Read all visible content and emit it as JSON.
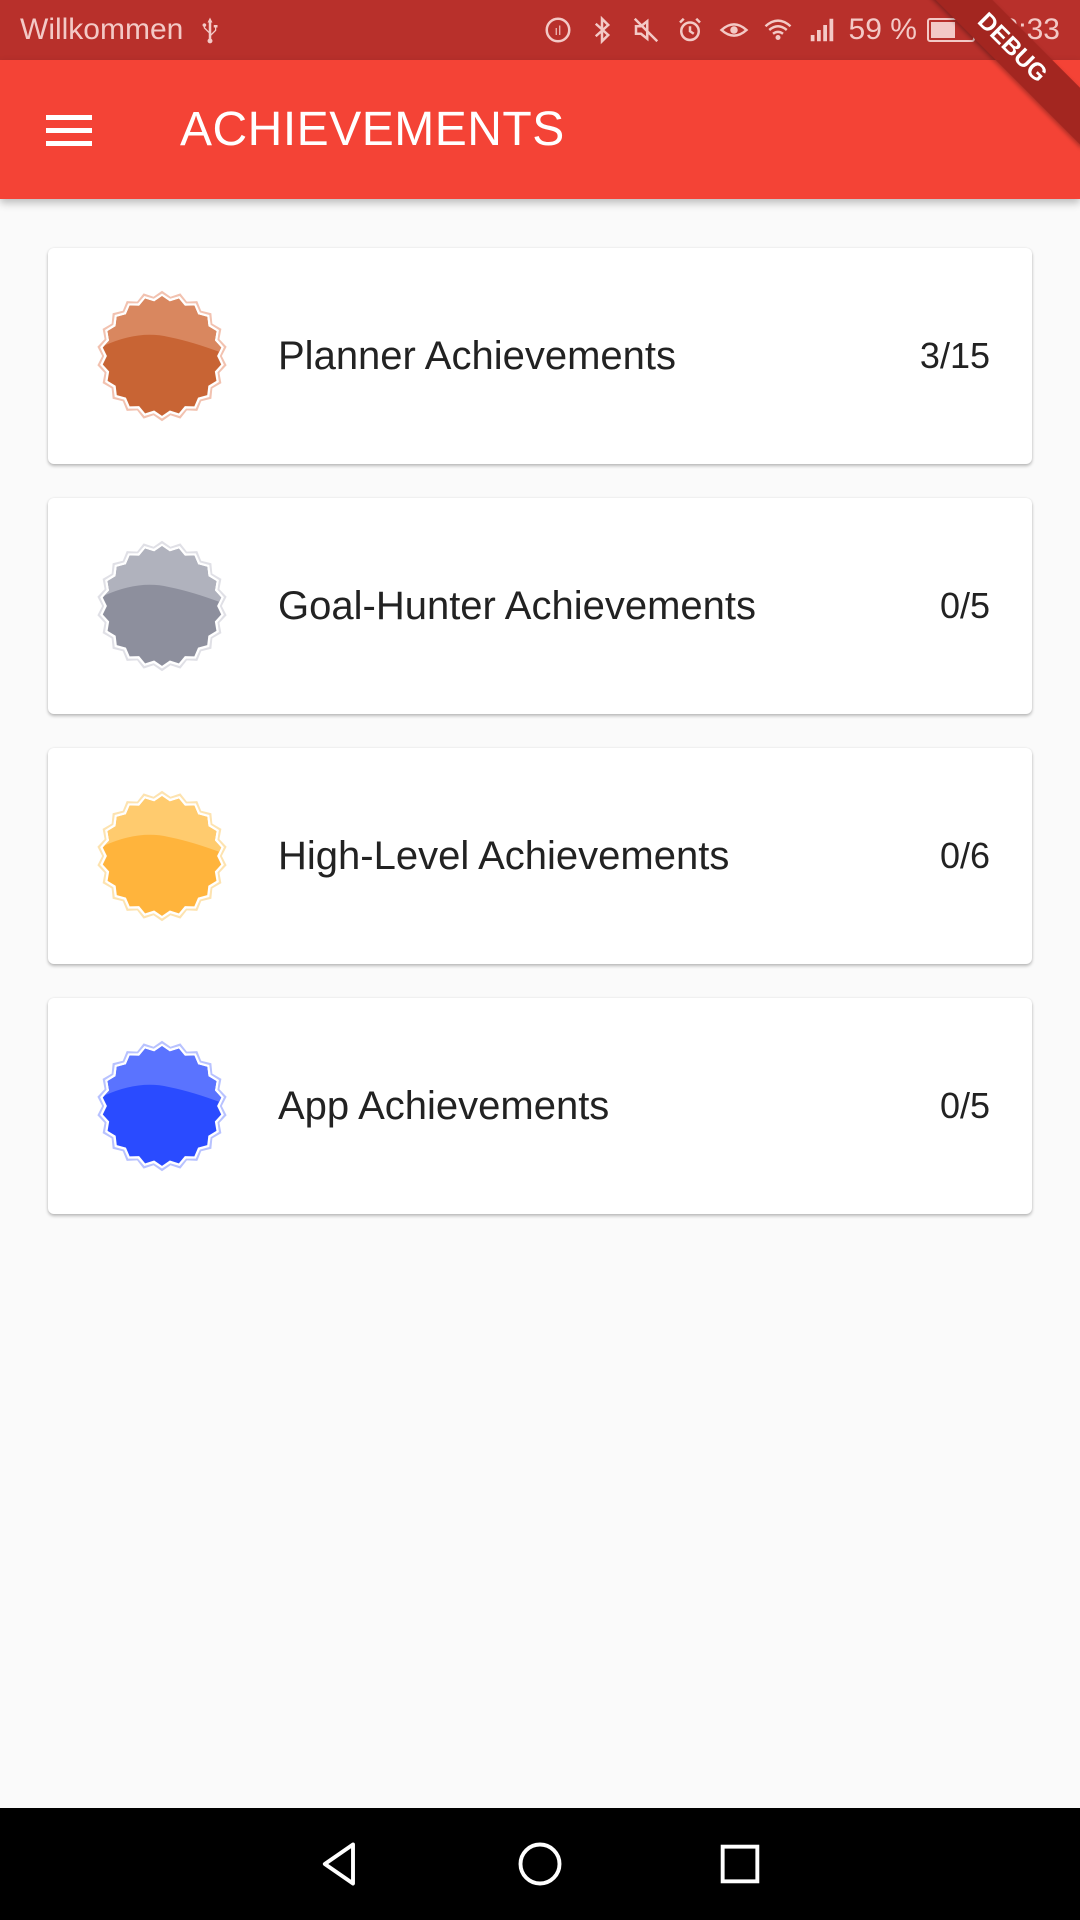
{
  "status_bar": {
    "carrier": "Willkommen",
    "battery_percent": "59 %",
    "battery_level": 0.59,
    "time": "12:33",
    "icons": [
      "usb-icon",
      "data-saver-icon",
      "bluetooth-icon",
      "mute-icon",
      "alarm-icon",
      "eye-comfort-icon",
      "wifi-icon",
      "signal-icon",
      "battery-icon"
    ]
  },
  "debug_banner": "DEBUG",
  "app_bar": {
    "title": "ACHIEVEMENTS",
    "menu_icon": "hamburger-menu-icon",
    "color": "#f44336"
  },
  "achievements": [
    {
      "label": "Planner Achievements",
      "count": "3/15",
      "badge_color": "#c86434",
      "badge_light": "#d9875f",
      "glow": "#f2c2b0"
    },
    {
      "label": "Goal-Hunter Achievements",
      "count": "0/5",
      "badge_color": "#8d8f9d",
      "badge_light": "#b0b2bd",
      "glow": "#e0e0e6"
    },
    {
      "label": "High-Level Achievements",
      "count": "0/6",
      "badge_color": "#ffb43c",
      "badge_light": "#ffcb6e",
      "glow": "#fde3b0"
    },
    {
      "label": "App Achievements",
      "count": "0/5",
      "badge_color": "#2a4bff",
      "badge_light": "#5a73ff",
      "glow": "#b8c2ff"
    }
  ],
  "nav_bar": {
    "icons": [
      "back-icon",
      "home-icon",
      "recents-icon"
    ]
  }
}
